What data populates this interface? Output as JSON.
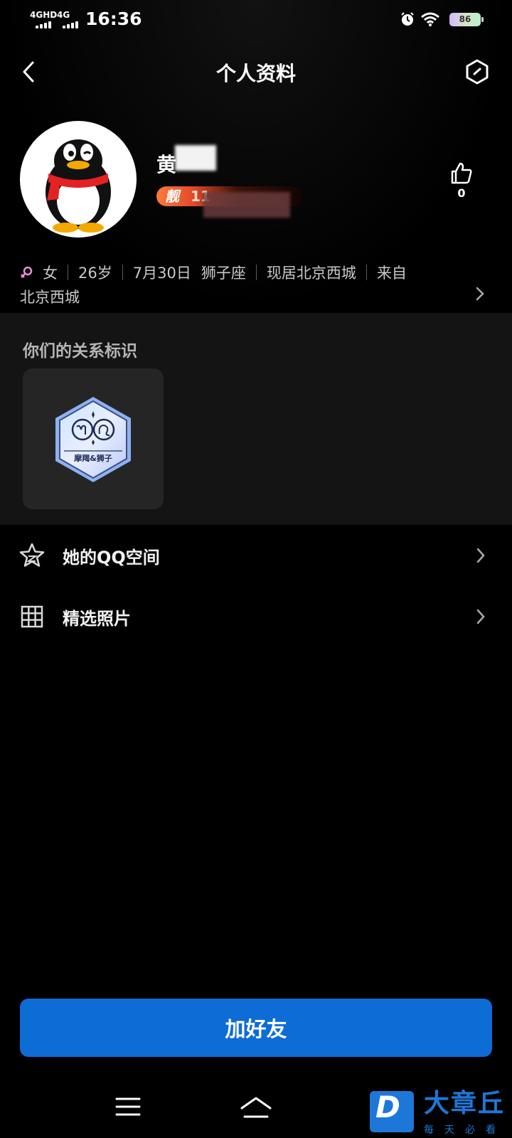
{
  "status_bar": {
    "signal1": "4GHD",
    "signal2": "4G",
    "time": "16:36",
    "battery": "86"
  },
  "header": {
    "title": "个人资料"
  },
  "profile": {
    "name_visible": "黄",
    "badge_char": "靓",
    "badge_digits": "11",
    "likes": "0"
  },
  "info": {
    "gender": "女",
    "age": "26岁",
    "birthday": "7月30日",
    "zodiac": "狮子座",
    "residence": "现居北京西城",
    "origin_prefix": "来自",
    "origin_place": "北京西城"
  },
  "relation": {
    "title": "你们的关系标识",
    "badge_label": "摩羯&狮子"
  },
  "menu": [
    {
      "label": "她的QQ空间",
      "icon": "star-icon"
    },
    {
      "label": "精选照片",
      "icon": "grid-icon"
    }
  ],
  "actions": {
    "add_friend": "加好友"
  },
  "watermark": {
    "logo_letter": "D",
    "title": "大章丘",
    "subtitle": "每天必看"
  },
  "colors": {
    "primary_button": "#0d6cd6",
    "background": "#000000",
    "section_bg": "#141414"
  }
}
